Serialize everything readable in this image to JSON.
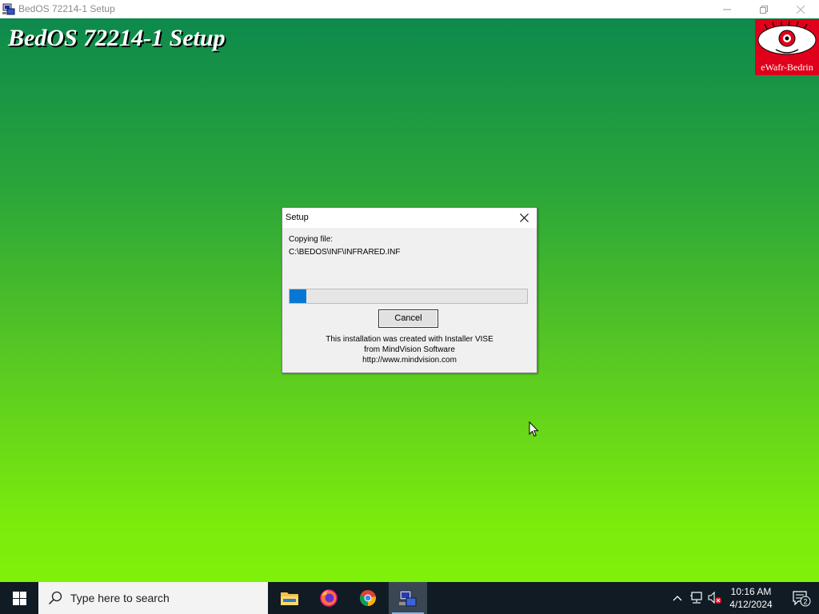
{
  "window": {
    "title": "BedOS 72214-1 Setup",
    "app_icon": "installer-icon",
    "controls": [
      "minimize",
      "restore",
      "close"
    ]
  },
  "desktop": {
    "heading": "BedOS 72214-1 Setup",
    "logo_text": "eWafr-Bedrin",
    "gradient_top": "#0d8a4c",
    "gradient_bottom": "#7ff10a"
  },
  "dialog": {
    "title": "Setup",
    "copying_label": "Copying file:",
    "file_path": "C:\\BEDOS\\INF\\INFRARED.INF",
    "progress": 0.07,
    "progress_color": "#0678d4",
    "cancel_label": "Cancel",
    "credit_line1": "This installation was created with Installer VISE",
    "credit_line2": "from MindVision Software",
    "credit_line3": "http://www.mindvision.com"
  },
  "taskbar": {
    "search_placeholder": "Type here to search",
    "apps": [
      "file-explorer-icon",
      "firefox-icon",
      "chrome-icon",
      "installer-icon"
    ],
    "active_app": "installer-icon",
    "time": "10:16 AM",
    "date": "4/12/2024",
    "notification_count": "2",
    "tray": [
      "chevron-up-icon",
      "network-icon",
      "volume-muted-icon"
    ]
  }
}
